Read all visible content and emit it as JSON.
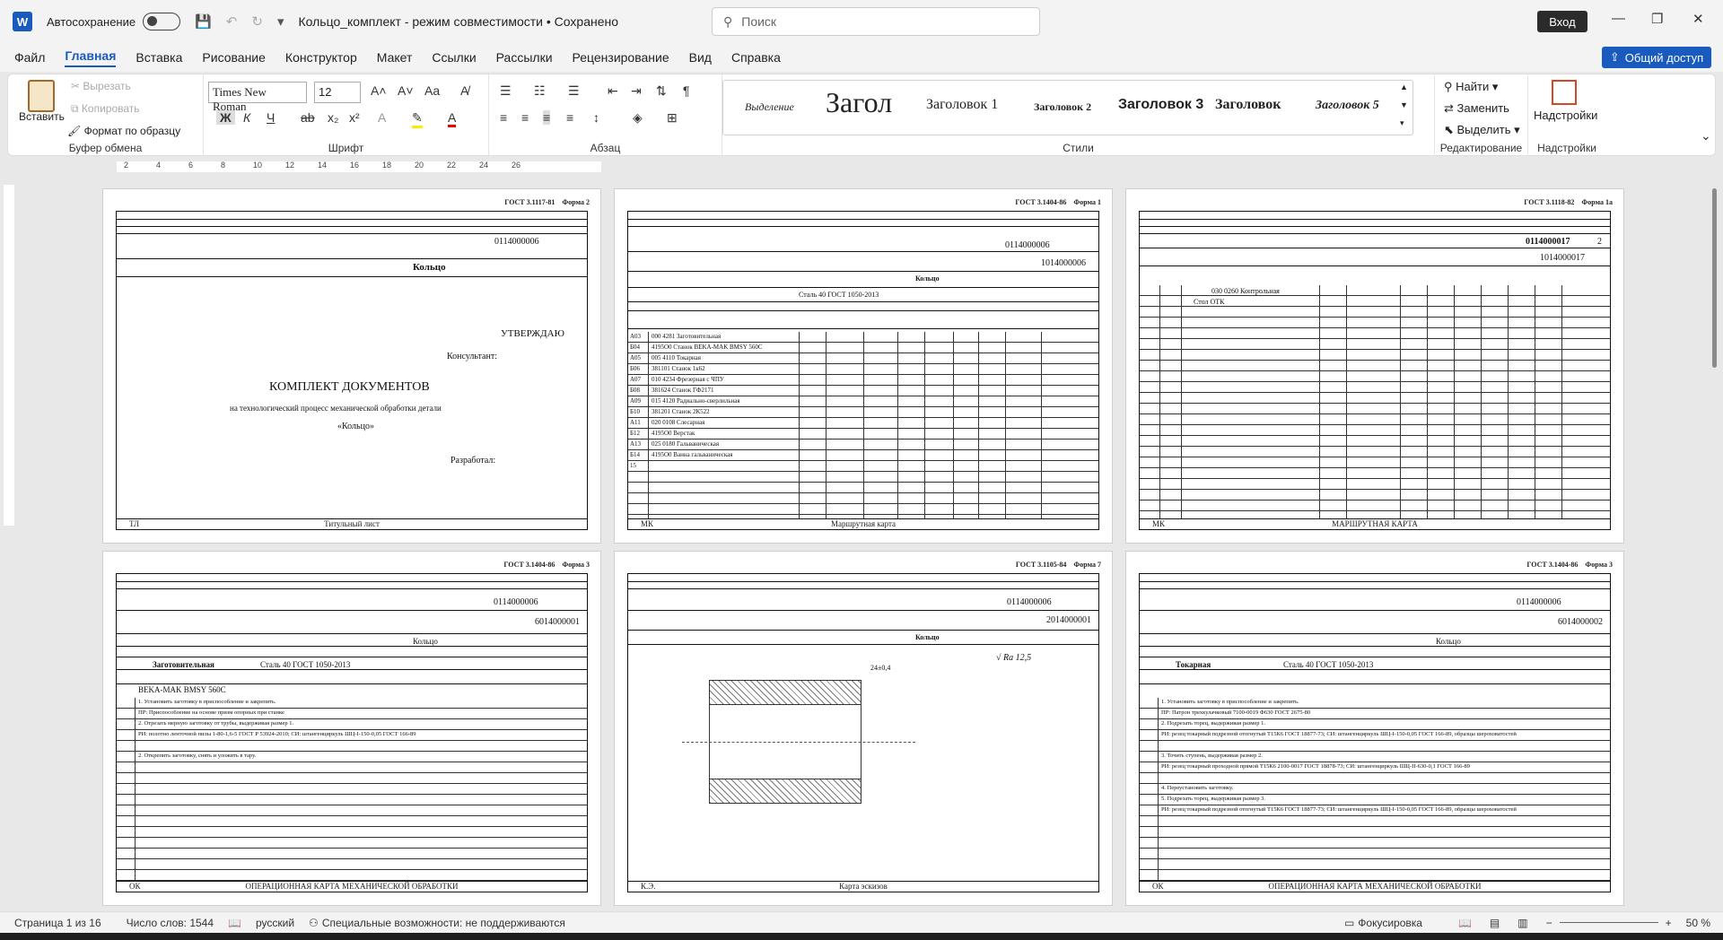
{
  "titlebar": {
    "autosave_label": "Автосохранение",
    "doc_title": "Кольцо_комплект  -  режим совместимости • Сохранено",
    "search_placeholder": "Поиск",
    "login": "Вход"
  },
  "menu": {
    "tabs": [
      "Файл",
      "Главная",
      "Вставка",
      "Рисование",
      "Конструктор",
      "Макет",
      "Ссылки",
      "Рассылки",
      "Рецензирование",
      "Вид",
      "Справка"
    ],
    "active": "Главная",
    "share": "Общий доступ"
  },
  "ribbon": {
    "clipboard": {
      "paste": "Вставить",
      "cut": "Вырезать",
      "copy": "Копировать",
      "format_painter": "Формат по образцу",
      "label": "Буфер обмена"
    },
    "font": {
      "name": "Times New Roman",
      "size": "12",
      "label": "Шрифт",
      "bold": "Ж",
      "italic": "К",
      "underline": "Ч",
      "strike": "ab",
      "sub": "x₂",
      "sup": "x²"
    },
    "paragraph": {
      "label": "Абзац"
    },
    "styles": {
      "label": "Стили",
      "items": [
        "Выделение",
        "Загол",
        "Заголовок 1",
        "Заголовок 2",
        "Заголовок 3",
        "Заголовок",
        "Заголовок 5"
      ]
    },
    "editing": {
      "label": "Редактирование",
      "find": "Найти",
      "replace": "Заменить",
      "select": "Выделить"
    },
    "addins": {
      "label": "Надстройки",
      "button": "Надстройки"
    }
  },
  "ruler": {
    "ticks": [
      "2",
      "4",
      "6",
      "8",
      "10",
      "12",
      "14",
      "16",
      "18",
      "20",
      "22",
      "24",
      "26"
    ]
  },
  "pages": {
    "p1": {
      "gost": "ГОСТ 3.1117-81",
      "form": "Форма 2",
      "code": "0114000006",
      "name": "Кольцо",
      "approve": "УТВЕРЖДАЮ",
      "consultant": "Консультант:",
      "title": "КОМПЛЕКТ ДОКУМЕНТОВ",
      "subtitle": "на технологический процесс механической обработки детали",
      "detail": "«Кольцо»",
      "developed": "Разработал:",
      "footer_code": "ТЛ",
      "footer": "Титульный лист"
    },
    "p2": {
      "gost": "ГОСТ 3.1404-86",
      "form": "Форма 1",
      "code1": "0114000006",
      "code2": "1014000006",
      "name": "Кольцо",
      "material": "Сталь 40 ГОСТ 1050-2013",
      "footer_code": "МК",
      "footer": "Маршрутная карта",
      "rows": [
        "А03",
        "Б04",
        "А05",
        "Б06",
        "А07",
        "Б08",
        "А09",
        "Б10",
        "А11",
        "Б12",
        "А13",
        "Б14",
        "15"
      ],
      "ops": [
        "000  4281  Заготовительная",
        "4195О0  Станок BEKA-MAK BMSY 560C",
        "005  4110  Токарная",
        "381101  Станок 1к62",
        "010  4234  Фрезерная с ЧПУ",
        "381624  Станок ГФ2171",
        "015  4120  Радиально-сверлильная",
        "381201  Станок 2К522",
        "020  0108  Слесарная",
        "4195О0  Верстак",
        "025  0180  Гальваническая",
        "4195О0  Ванна гальваническая",
        ""
      ]
    },
    "p3": {
      "gost": "ГОСТ 3.1118-82",
      "form": "Форма 1а",
      "code1": "0114000017",
      "code2": "1014000017",
      "sheet": "2",
      "op": "030  0260  Контрольная",
      "equip": "Стол ОТК",
      "footer_code": "МК",
      "footer": "МАРШРУТНАЯ КАРТА"
    },
    "p4": {
      "gost": "ГОСТ 3.1404-86",
      "form": "Форма 3",
      "code1": "0114000006",
      "code2": "6014000001",
      "name": "Кольцо",
      "op": "Заготовительная",
      "material": "Сталь 40 ГОСТ 1050-2013",
      "equip": "BEKA-MAK BMSY 560C",
      "footer_code": "ОК",
      "footer": "ОПЕРАЦИОННАЯ КАРТА МЕХАНИЧЕСКОЙ ОБРАБОТКИ",
      "lines": [
        "1. Установить заготовку в приспособление и закрепить.",
        "ПР: Приспособление на основе призм опорных при станке",
        "2. Отрезать мерную заготовку от трубы, выдерживая размер 1.",
        "РИ: полотно ленточной пилы 1-80-1,6-5 ГОСТ Р 53924-2010; СИ: штангенциркуль ШЦ-I-150-0,05 ГОСТ 166-89",
        "",
        "2. Открепить заготовку, снять и уложить в тару."
      ]
    },
    "p5": {
      "gost": "ГОСТ 3.1105-84",
      "form": "Форма 7",
      "code1": "0114000006",
      "code2": "2014000001",
      "name": "Кольцо",
      "dim": "24±0,4",
      "rough": "Ra 12,5",
      "footer_code": "К.Э.",
      "footer": "Карта эскизов"
    },
    "p6": {
      "gost": "ГОСТ 3.1404-86",
      "form": "Форма 3",
      "code1": "0114000006",
      "code2": "6014000002",
      "name": "Кольцо",
      "op": "Токарная",
      "material": "Сталь 40 ГОСТ 1050-2013",
      "footer_code": "ОК",
      "footer": "ОПЕРАЦИОННАЯ КАРТА МЕХАНИЧЕСКОЙ ОБРАБОТКИ",
      "lines": [
        "1. Установить заготовку в приспособление и закрепить.",
        "ПР: Патрон трехкулачковый 7100-0019 Ф630 ГОСТ 2675-80",
        "2. Подрезать торец, выдерживая размер 1.",
        "РИ: резец токарный подрезной отогнутый Т15К6 ГОСТ 18877-73;  СИ: штангенциркуль ШЦ-I-150-0,05 ГОСТ 166-89, образцы шероховатостей",
        "",
        "3. Точить ступень, выдерживая размер 2.",
        "РИ: резец токарный проходной прямой Т15К6 2100-0017 ГОСТ 18878-73;  СИ: штангенциркуль ШЦ-II-630-0,1 ГОСТ 166-89",
        "",
        "4. Переустановить заготовку.",
        "5. Подрезать торец, выдерживая размер 3.",
        "РИ: резец токарный подрезной отогнутый Т15К6 ГОСТ 18877-73;  СИ: штангенциркуль ШЦ-I-150-0,05 ГОСТ 166-89, образцы шероховатостей"
      ]
    }
  },
  "status": {
    "page": "Страница 1 из 16",
    "words": "Число слов: 1544",
    "lang": "русский",
    "access": "Специальные возможности: не поддерживаются",
    "focus": "Фокусировка",
    "zoom": "50 %"
  }
}
